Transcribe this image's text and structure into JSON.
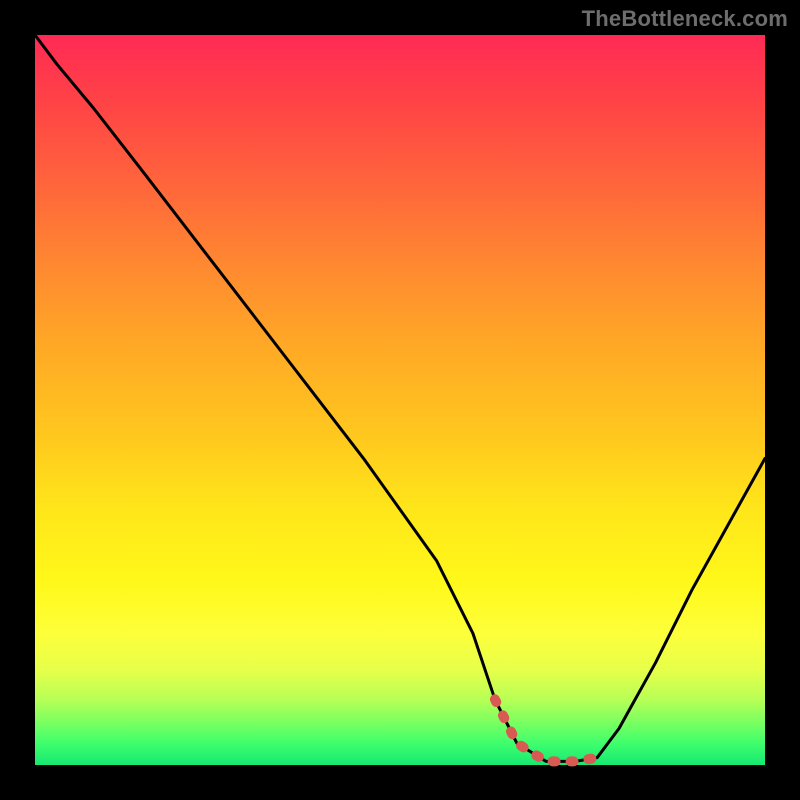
{
  "watermark": "TheBottleneck.com",
  "colors": {
    "frame": "#000000",
    "curve": "#000000",
    "dash": "#d85a52",
    "gradient_top": "#ff2a55",
    "gradient_bottom": "#16e873"
  },
  "chart_data": {
    "type": "line",
    "title": "",
    "xlabel": "",
    "ylabel": "",
    "xlim": [
      0,
      100
    ],
    "ylim": [
      0,
      100
    ],
    "series": [
      {
        "name": "bottleneck_curve",
        "x": [
          0,
          3,
          8,
          15,
          25,
          35,
          45,
          55,
          60,
          63,
          66,
          70,
          74,
          77,
          80,
          85,
          90,
          95,
          100
        ],
        "y": [
          100,
          96,
          90,
          81,
          68,
          55,
          42,
          28,
          18,
          9,
          3,
          0.5,
          0.5,
          1,
          5,
          14,
          24,
          33,
          42
        ]
      }
    ],
    "highlight_segment": {
      "name": "dashed_bottom",
      "x": [
        63,
        66,
        70,
        74,
        77
      ],
      "y": [
        9,
        3,
        0.5,
        0.5,
        1
      ],
      "style": "dashed",
      "color": "#d85a52"
    },
    "background_gradient": {
      "direction": "vertical",
      "stops": [
        {
          "pos": 0.0,
          "color": "#ff2a55"
        },
        {
          "pos": 0.5,
          "color": "#ffc81e"
        },
        {
          "pos": 0.85,
          "color": "#fdff3a"
        },
        {
          "pos": 1.0,
          "color": "#16e873"
        }
      ]
    }
  }
}
